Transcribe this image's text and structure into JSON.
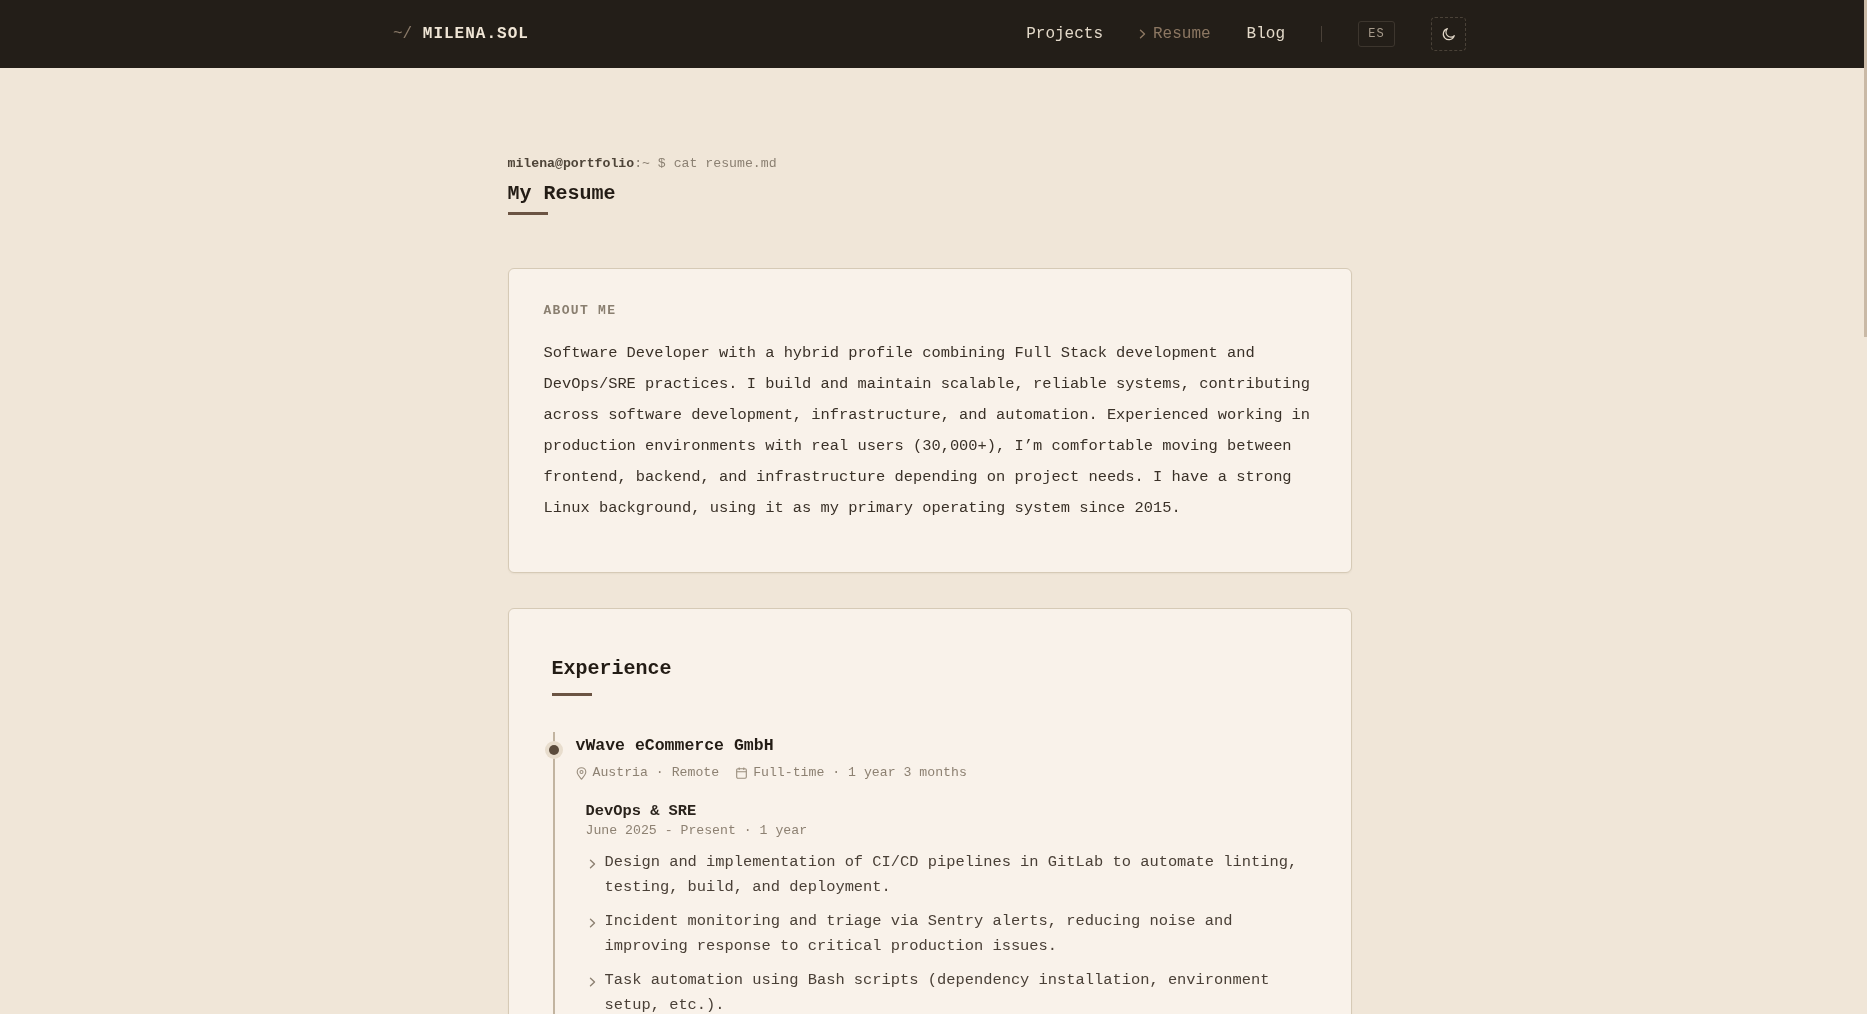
{
  "header": {
    "logo": {
      "prefix": "~/",
      "name": "MILENA.SOL"
    },
    "nav": [
      {
        "label": "Projects",
        "selected": false
      },
      {
        "label": "Resume",
        "selected": true
      },
      {
        "label": "Blog",
        "selected": false
      }
    ],
    "language": "ES"
  },
  "page": {
    "prompt": "**milena@portfolio**:~ $ cat resume.md",
    "title": "My Resume"
  },
  "about": {
    "heading": "ABOUT ME",
    "text": "Software Developer with a hybrid profile combining Full Stack development and DevOps/SRE practices. I build and maintain scalable, reliable systems, contributing across software development, infrastructure, and automation. Experienced working in production environments with real users (30,000+), I’m comfortable moving between frontend, backend, and infrastructure depending on project needs. I have a strong Linux background, using it as my primary operating system since 2015."
  },
  "experience": {
    "heading": "Experience",
    "companies": [
      {
        "name": "vWave eCommerce GmbH",
        "location": "Austria · Remote",
        "employment": "Full-time · 1 year 3 months",
        "roles": [
          {
            "title": "DevOps & SRE",
            "period": "June 2025 - Present · 1 year",
            "bullets": [
              "Design and implementation of CI/CD pipelines in GitLab to automate linting, testing, build, and deployment.",
              "Incident monitoring and triage via Sentry alerts, reducing noise and improving response to critical production issues.",
              "Task automation using Bash scripts (dependency installation, environment setup, etc.)."
            ]
          }
        ]
      }
    ]
  }
}
